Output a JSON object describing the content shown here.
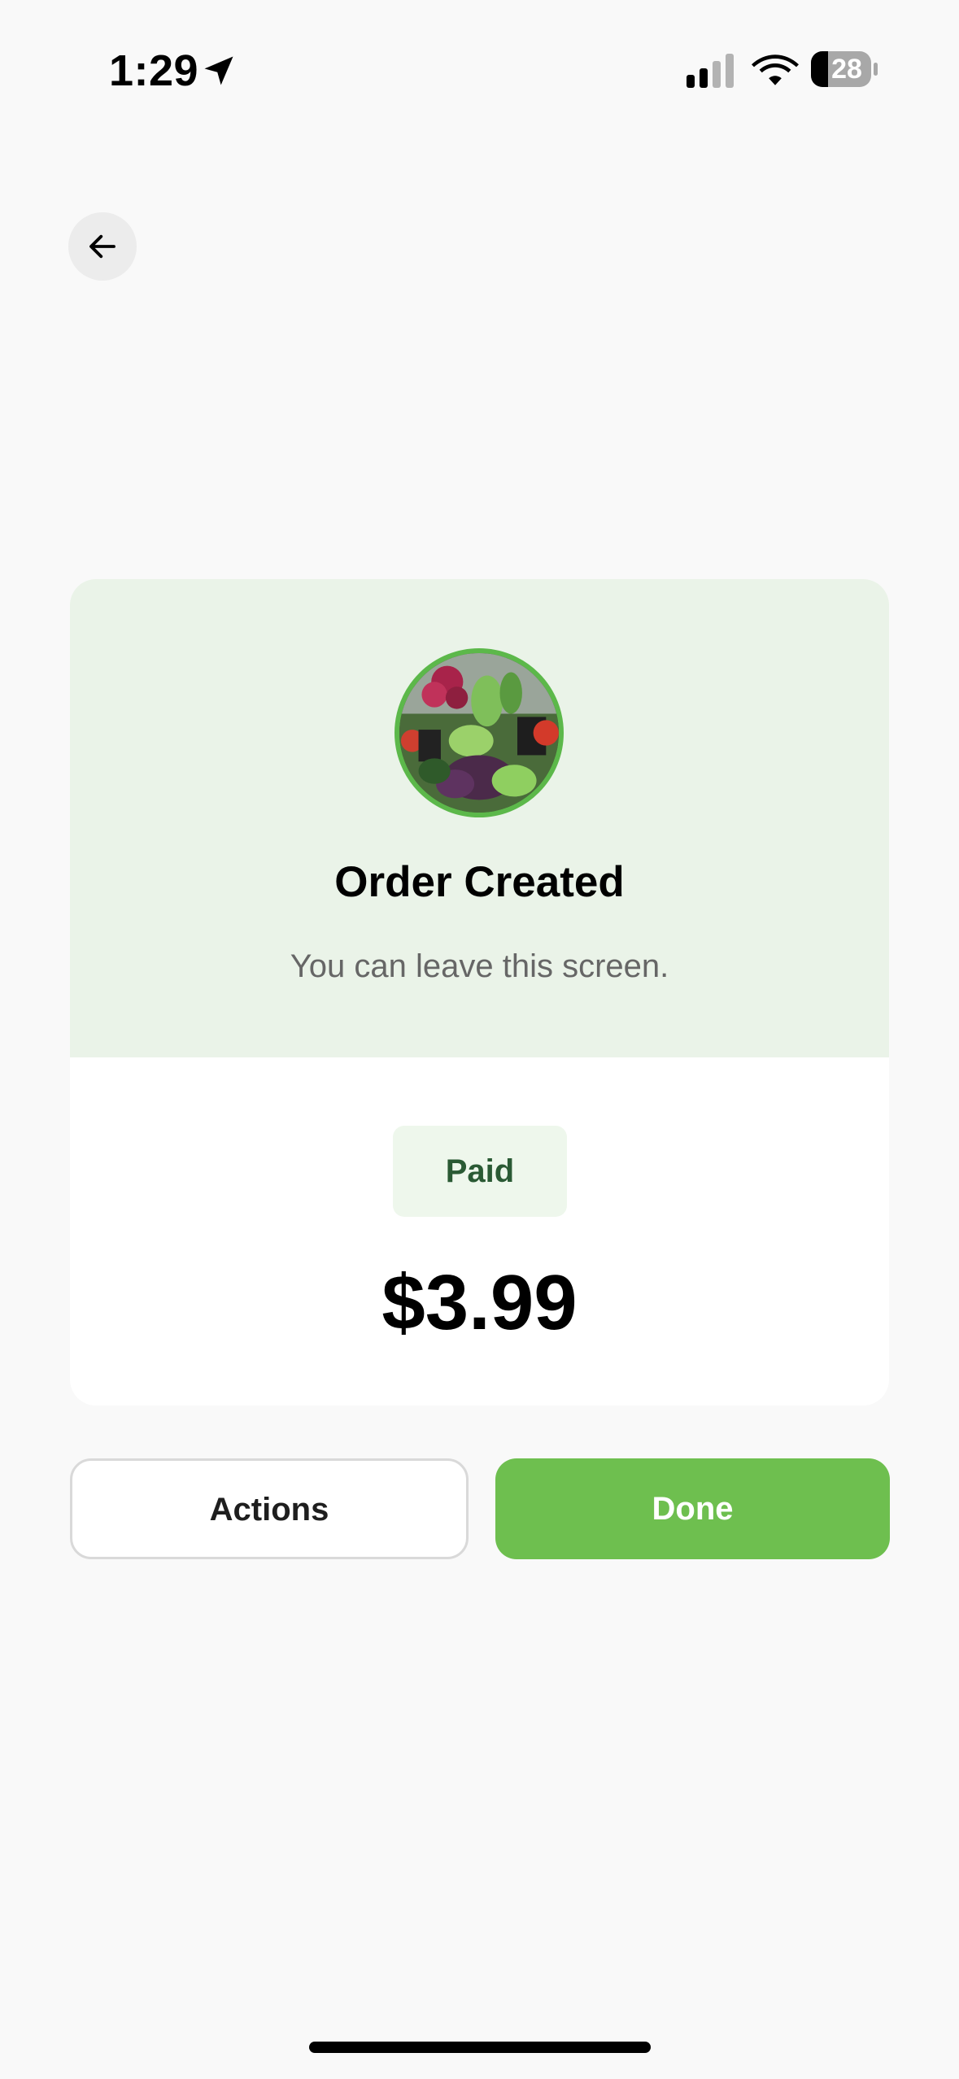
{
  "status_bar": {
    "time": "1:29",
    "battery_level": "28",
    "icons": [
      "location-arrow-icon",
      "cellular-signal-icon",
      "wifi-icon",
      "battery-icon"
    ]
  },
  "navigation": {
    "back_icon": "arrow-left-icon"
  },
  "order": {
    "title": "Order Created",
    "subtitle": "You can leave this screen.",
    "payment_status": "Paid",
    "amount": "$3.99",
    "avatar_image": "merchant-produce-photo"
  },
  "buttons": {
    "actions_label": "Actions",
    "done_label": "Done"
  },
  "colors": {
    "accent_green": "#6ebf4f",
    "card_header_bg": "#eaf3e8",
    "badge_bg": "#eef7ec",
    "badge_text": "#2a5a34",
    "page_bg": "#f9f9f9"
  }
}
